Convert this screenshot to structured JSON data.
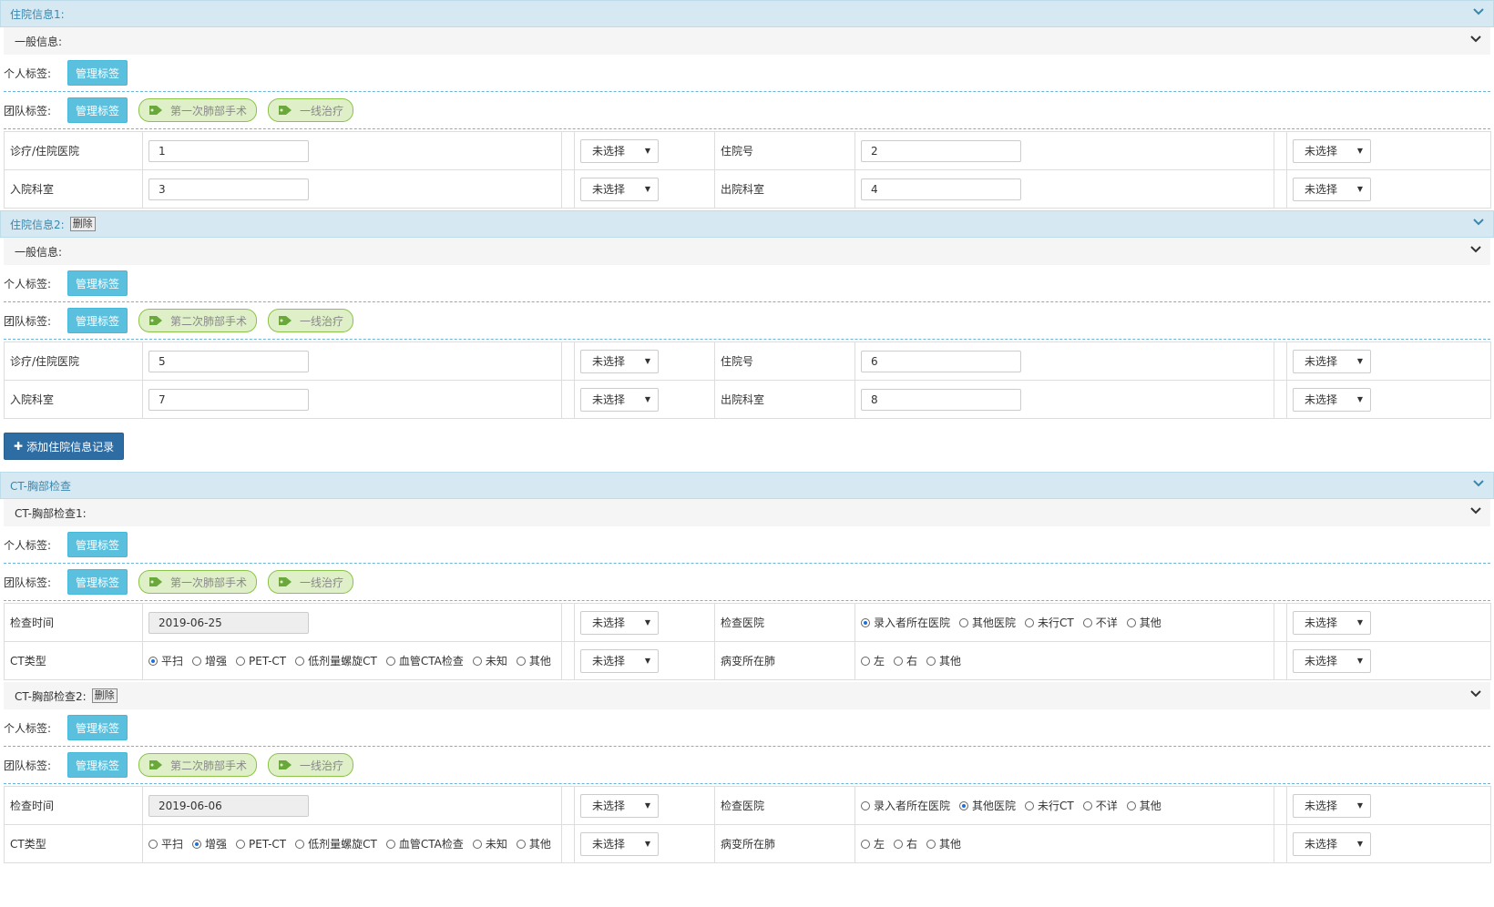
{
  "labels": {
    "general_info": "一般信息:",
    "personal_tag": "个人标签:",
    "team_tag": "团队标签:",
    "manage_tag": "管理标签",
    "delete": "删除",
    "unselected": "未选择",
    "add_record": "添加住院信息记录",
    "hospital": "诊疗/住院医院",
    "admission_no": "住院号",
    "admit_dept": "入院科室",
    "discharge_dept": "出院科室",
    "exam_time": "检查时间",
    "exam_hospital": "检查医院",
    "ct_type": "CT类型",
    "lesion_lung": "病变所在肺"
  },
  "hosp1": {
    "title": "住院信息1:",
    "tags": [
      "第一次肺部手术",
      "一线治疗"
    ],
    "hospital": "1",
    "admission_no": "2",
    "admit_dept": "3",
    "discharge_dept": "4"
  },
  "hosp2": {
    "title": "住院信息2:",
    "tags": [
      "第二次肺部手术",
      "一线治疗"
    ],
    "hospital": "5",
    "admission_no": "6",
    "admit_dept": "7",
    "discharge_dept": "8"
  },
  "ct": {
    "title": "CT-胸部检查",
    "ct_type_options": [
      "平扫",
      "增强",
      "PET-CT",
      "低剂量螺旋CT",
      "血管CTA检查",
      "未知",
      "其他"
    ],
    "hospital_options": [
      "录入者所在医院",
      "其他医院",
      "未行CT",
      "不详",
      "其他"
    ],
    "lung_options": [
      "左",
      "右",
      "其他"
    ],
    "exam1": {
      "title": "CT-胸部检查1:",
      "tags": [
        "第一次肺部手术",
        "一线治疗"
      ],
      "date": "2019-06-25",
      "hospital_selected": 0,
      "ct_type_selected": 0
    },
    "exam2": {
      "title": "CT-胸部检查2:",
      "tags": [
        "第二次肺部手术",
        "一线治疗"
      ],
      "date": "2019-06-06",
      "hospital_selected": 1,
      "ct_type_selected": 1
    }
  },
  "icons": {
    "collapse": "chevron-down-icon",
    "tag": "tag-icon",
    "add": "plus-icon"
  }
}
